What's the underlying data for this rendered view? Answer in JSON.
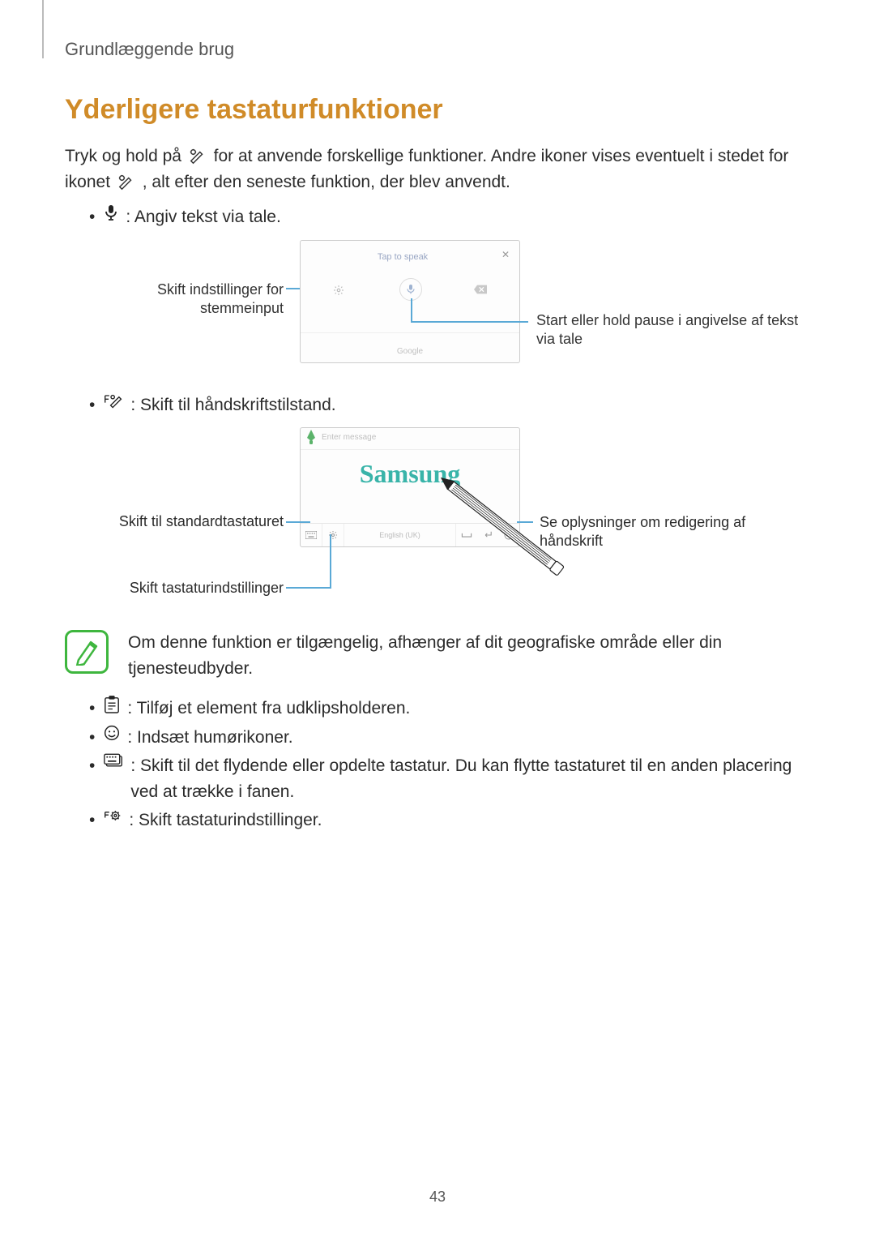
{
  "runningHead": "Grundlæggende brug",
  "sectionTitle": "Yderligere tastaturfunktioner",
  "intro": {
    "part1": "Tryk og hold på ",
    "part2": " for at anvende forskellige funktioner. Andre ikoner vises eventuelt i stedet for ikonet ",
    "part3": ", alt efter den seneste funktion, der blev anvendt."
  },
  "bullet_voice": " : Angiv tekst via tale.",
  "fig1": {
    "tapToSpeak": "Tap to speak",
    "google": "Google",
    "calloutLeft": "Skift indstillinger for stemmeinput",
    "calloutRight": "Start eller hold pause i angivelse af tekst via tale"
  },
  "bullet_hand": " : Skift til håndskriftstilstand.",
  "fig2": {
    "enterHint": "Enter message",
    "handwriting": "Samsung",
    "lang": "English (UK)",
    "calloutLeft1": "Skift til standardtastaturet",
    "calloutLeft2": "Skift tastaturindstillinger",
    "calloutRight": "Se oplysninger om redigering af håndskrift"
  },
  "noteText": "Om denne funktion er tilgængelig, afhænger af dit geografiske område eller din tjenesteudbyder.",
  "bullet_clip": " : Tilføj et element fra udklipsholderen.",
  "bullet_emoji": " : Indsæt humørikoner.",
  "bullet_float": " : Skift til det flydende eller opdelte tastatur. Du kan flytte tastaturet til en anden placering ved at trække i fanen.",
  "bullet_settings": " : Skift tastaturindstillinger.",
  "pageNumber": "43"
}
